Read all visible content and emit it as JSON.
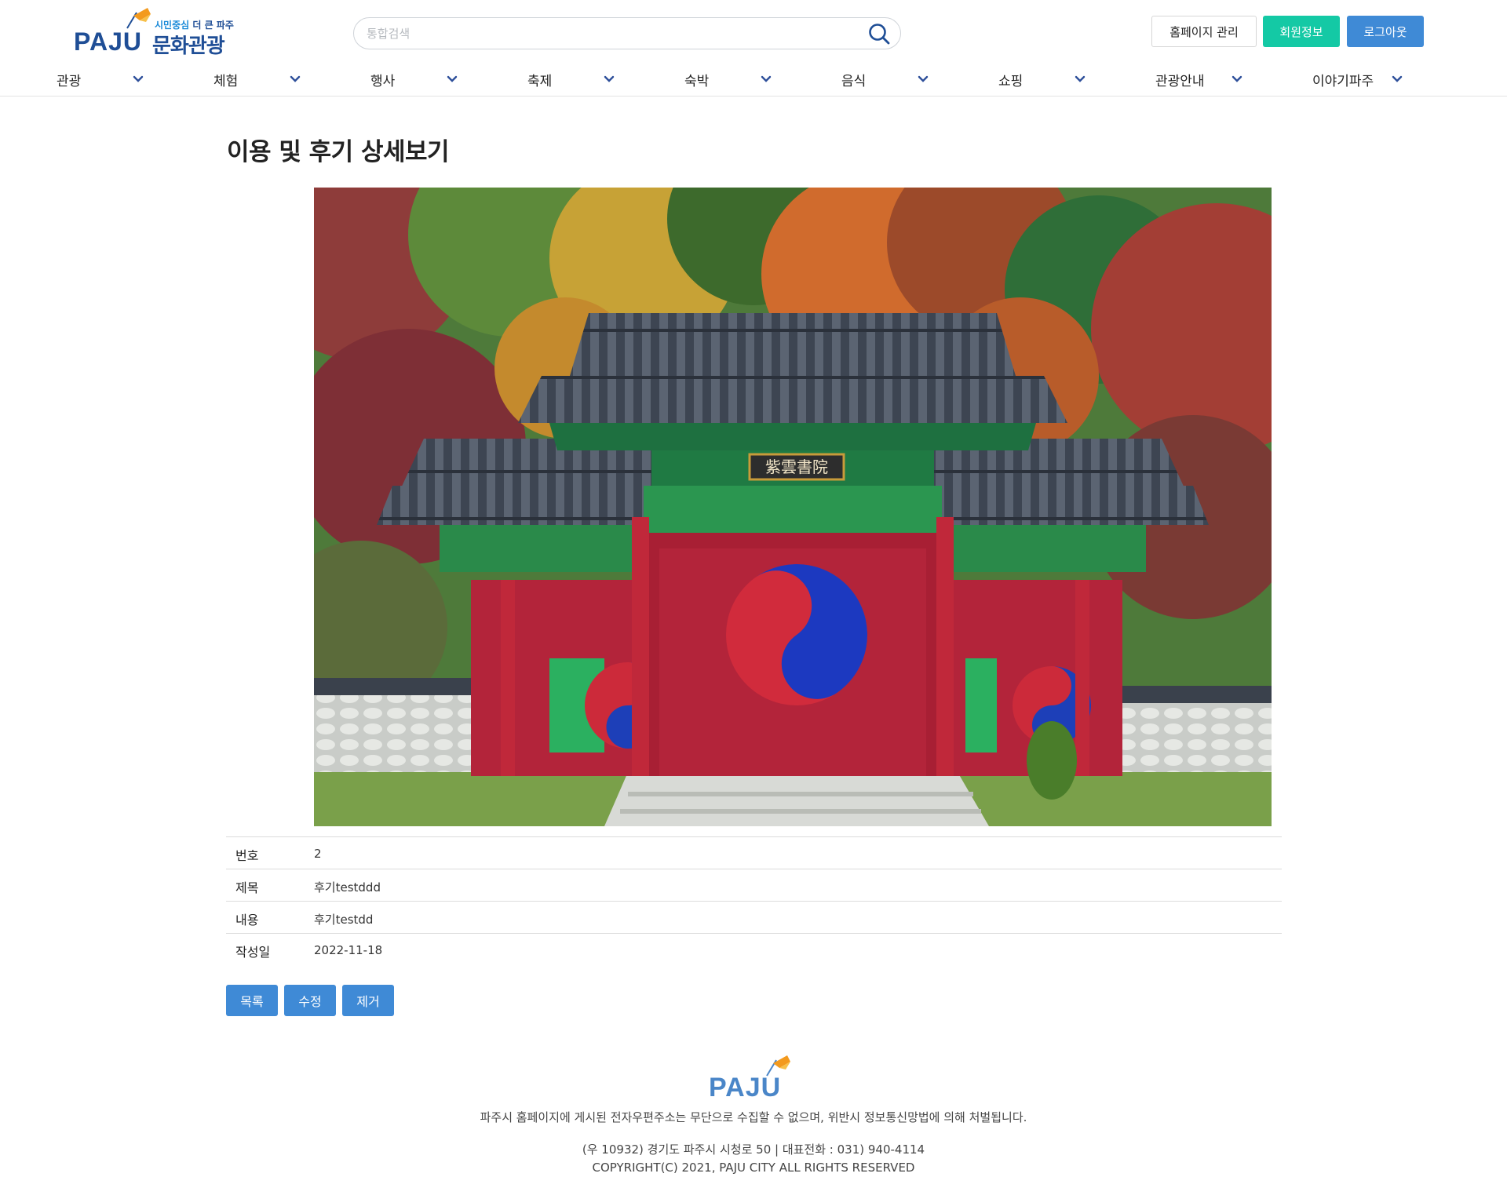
{
  "header": {
    "logo": {
      "brand": "PAJU",
      "slogan_a": "시민중심",
      "slogan_b": "더 큰 파주",
      "title": "문화관광"
    },
    "search": {
      "placeholder": "통합검색",
      "value": ""
    },
    "buttons": {
      "admin": "홈페이지 관리",
      "member": "회원정보",
      "logout": "로그아웃"
    },
    "nav": [
      {
        "label": "관광"
      },
      {
        "label": "체험"
      },
      {
        "label": "행사"
      },
      {
        "label": "축제"
      },
      {
        "label": "숙박"
      },
      {
        "label": "음식"
      },
      {
        "label": "쇼핑"
      },
      {
        "label": "관광안내"
      },
      {
        "label": "이야기파주"
      }
    ]
  },
  "main": {
    "title": "이용 및 후기 상세보기",
    "image": {
      "plaque": "紫雲書院"
    },
    "detail": [
      {
        "label": "번호",
        "value": "2"
      },
      {
        "label": "제목",
        "value": "후기testddd"
      },
      {
        "label": "내용",
        "value": "후기testdd"
      },
      {
        "label": "작성일",
        "value": "2022-11-18"
      }
    ],
    "actions": {
      "list": "목록",
      "edit": "수정",
      "delete": "제거"
    }
  },
  "footer": {
    "brand": "PAJU",
    "notice": "파주시 홈페이지에 게시된 전자우편주소는 무단으로 수집할 수 없으며, 위반시 정보통신망법에 의해 처벌됩니다.",
    "address": "(우 10932) 경기도 파주시 시청로 50 | 대표전화 : 031) 940-4114",
    "copyright": "COPYRIGHT(C) 2021, PAJU CITY ALL RIGHTS RESERVED"
  },
  "colors": {
    "brand_blue": "#1f4e96",
    "button_blue": "#3f8ad6",
    "member_teal": "#14c9a5",
    "kite_orange": "#f39a1e"
  },
  "icons": [
    "search-icon",
    "chevron-down-icon",
    "kite-icon"
  ]
}
